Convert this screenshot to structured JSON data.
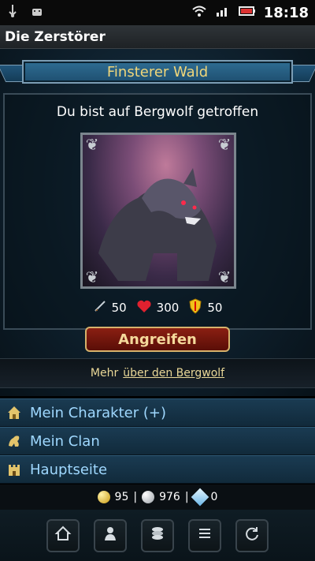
{
  "status_bar": {
    "time": "18:18",
    "icons": [
      "usb-icon",
      "android-icon",
      "wifi-icon",
      "signal-icon",
      "battery-icon"
    ]
  },
  "app": {
    "title": "Die Zerstörer"
  },
  "encounter": {
    "location": "Finsterer Wald",
    "message": "Du bist auf Bergwolf getroffen",
    "stats": {
      "attack": "50",
      "health": "300",
      "defense": "50"
    },
    "attack_button": "Angreifen",
    "more_prefix": "Mehr",
    "more_link": "über den Bergwolf"
  },
  "menu": {
    "items": [
      {
        "label": "Mein Charakter (+)",
        "icon": "character-icon"
      },
      {
        "label": "Mein Clan",
        "icon": "clan-icon"
      },
      {
        "label": "Hauptseite",
        "icon": "castle-icon"
      }
    ]
  },
  "currency": {
    "gold": "95",
    "separator": "|",
    "silver": "976",
    "diamonds": "0"
  },
  "toolbar": {
    "buttons": [
      "home-icon",
      "profile-icon",
      "coins-icon",
      "list-icon",
      "refresh-icon"
    ]
  },
  "colors": {
    "accent_blue": "#9fd8ff",
    "gold_text": "#f0d67a",
    "attack_button_red": "#8a1f12"
  }
}
